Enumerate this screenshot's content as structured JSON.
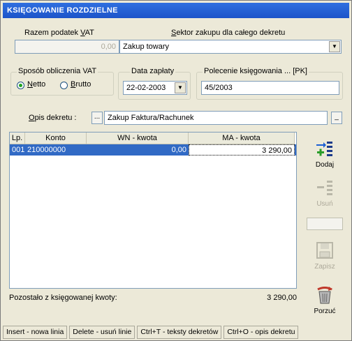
{
  "window": {
    "title": "KSIĘGOWANIE ROZDZIELNE"
  },
  "fields": {
    "vat_total_label_pre": "Razem podatek ",
    "vat_total_label_accel": "V",
    "vat_total_label_post": "AT",
    "vat_total_value": "0,00",
    "sector_label_accel": "S",
    "sector_label_post": "ektor zakupu dla całego dekretu",
    "sector_value": "Zakup towary",
    "vat_method_label": "Sposób obliczenia VAT",
    "vat_method_options": [
      {
        "accel": "N",
        "rest": "etto",
        "selected": true
      },
      {
        "accel": "B",
        "rest": "rutto",
        "selected": false
      }
    ],
    "payment_date_label": "Data zapłaty",
    "payment_date_value": "22-02-2003",
    "booking_order_label": "Polecenie księgowania ... [PK]",
    "booking_order_value": "45/2003",
    "description_label_accel": "O",
    "description_label_post": "pis dekretu :",
    "description_value": "Zakup Faktura/Rachunek",
    "ellipsis": "...",
    "minus": "_"
  },
  "grid": {
    "columns": [
      "Lp.",
      "Konto",
      "WN - kwota",
      "MA - kwota"
    ],
    "rows": [
      {
        "lp": "001",
        "konto": "210000000",
        "wn": "0,00",
        "ma": "3 290,00"
      }
    ]
  },
  "toolbar": {
    "add_label": "Dodaj",
    "delete_label": "Usuń",
    "save_label": "Zapisz",
    "abandon_label": "Porzuć",
    "add_icon": "add-list-icon",
    "delete_icon": "remove-list-icon",
    "save_icon": "save-icon",
    "abandon_icon": "trash-icon"
  },
  "summary": {
    "label": "Pozostało z księgowanej kwoty:",
    "value": "3 290,00"
  },
  "statusbar": [
    "Insert - nowa linia",
    "Delete - usuń linie",
    "Ctrl+T - teksty dekretów",
    "Ctrl+O - opis dekretu"
  ],
  "colors": {
    "title_bar": "#1c54c9",
    "selection": "#316ac5",
    "window_bg": "#ece9d8"
  }
}
